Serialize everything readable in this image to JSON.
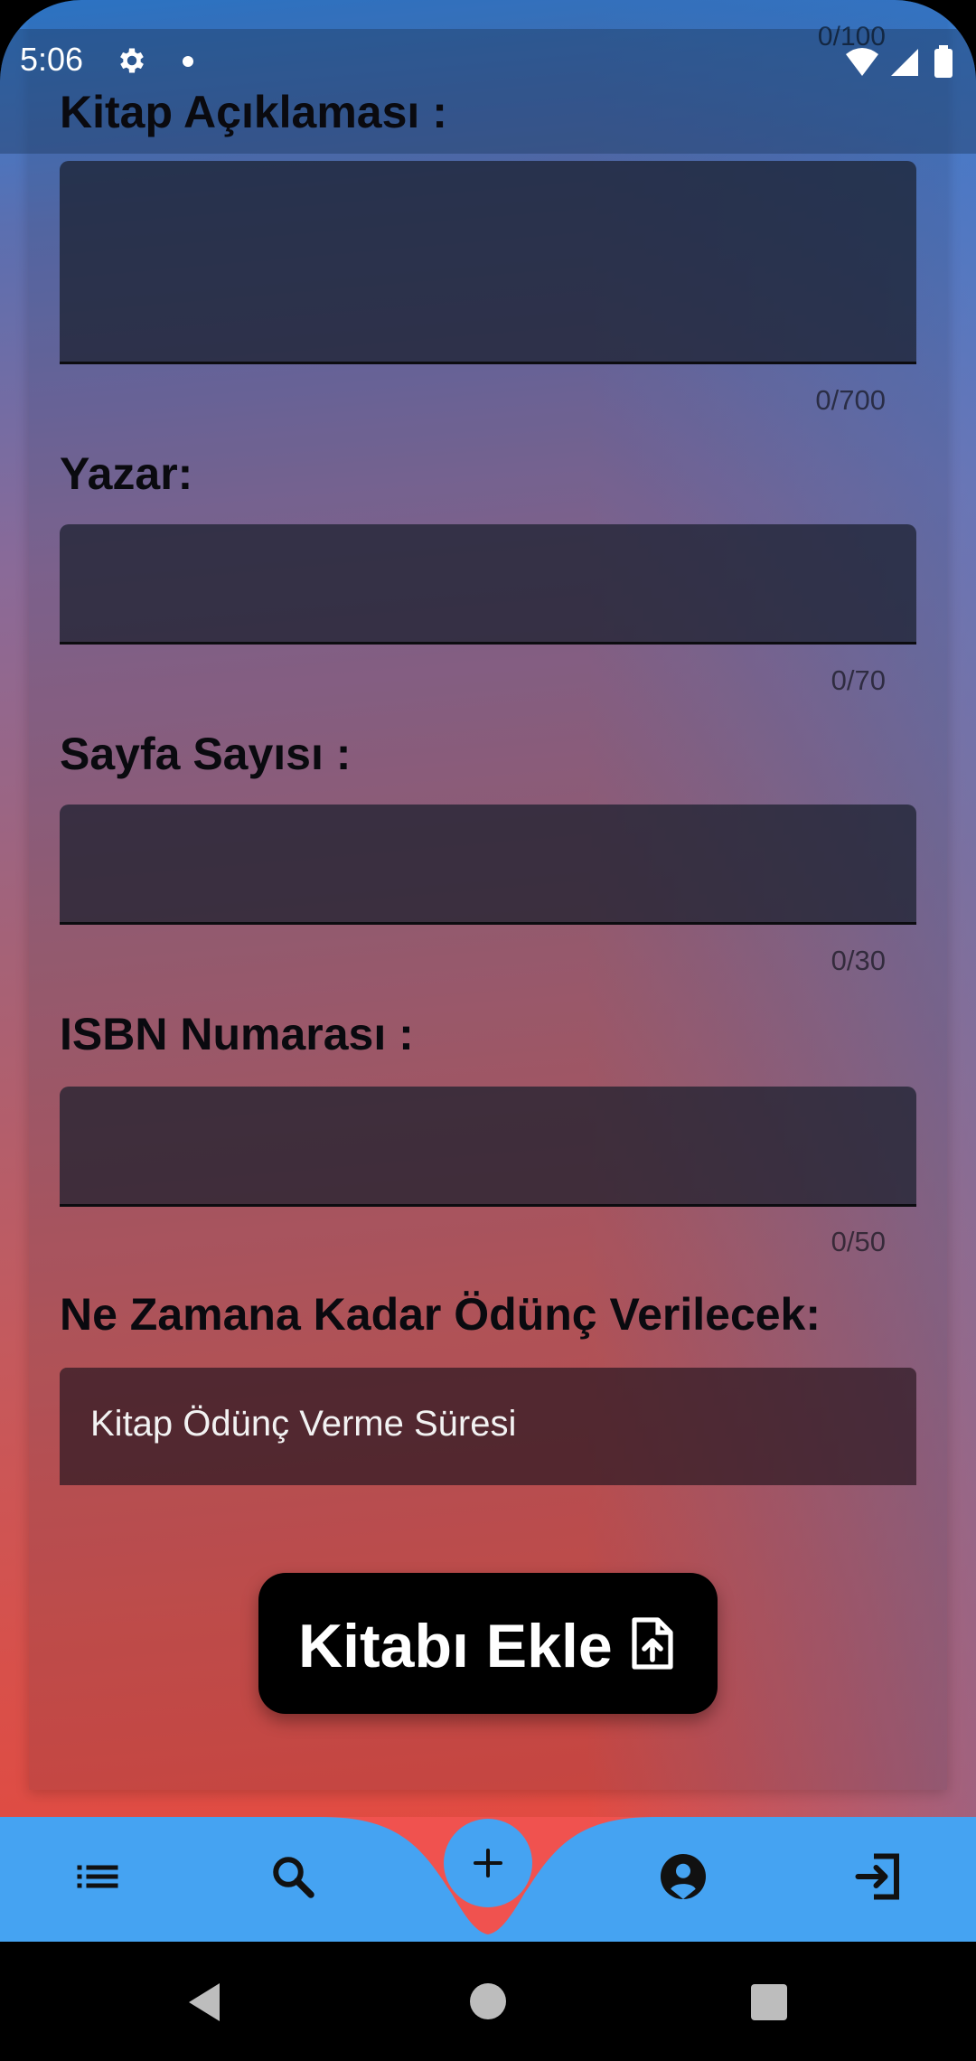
{
  "status_bar": {
    "time": "5:06",
    "icons": [
      "gear-icon",
      "notification-dot",
      "wifi-icon",
      "signal-icon",
      "battery-icon"
    ]
  },
  "form": {
    "top_counter": "0/100",
    "description": {
      "label": "Kitap Açıklaması :",
      "counter": "0/700",
      "value": ""
    },
    "author": {
      "label": "Yazar:",
      "counter": "0/70",
      "value": ""
    },
    "pages": {
      "label": "Sayfa Sayısı :",
      "counter": "0/30",
      "value": ""
    },
    "isbn": {
      "label": "ISBN Numarası :",
      "counter": "0/50",
      "value": ""
    },
    "loan": {
      "label": "Ne Zamana Kadar Ödünç Verilecek:",
      "selected": "Kitap Ödünç Verme Süresi"
    }
  },
  "submit_button": {
    "label": "Kitabı Ekle",
    "icon": "file-upload-icon"
  },
  "bottom_nav": {
    "items": [
      "list-icon",
      "search-icon",
      "add-icon",
      "account-icon",
      "logout-icon"
    ],
    "accent": "#45a3f2",
    "notch_color": "#f0524f"
  },
  "system_nav": [
    "back-icon",
    "home-icon",
    "recents-icon"
  ]
}
